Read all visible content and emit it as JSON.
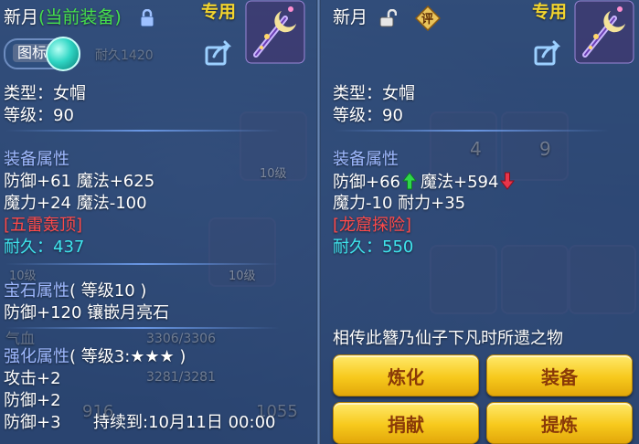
{
  "left": {
    "title_name": "新月",
    "title_status": "(当前装备)",
    "exclusive_label": "专用",
    "icon_toggle_label": "图标",
    "type_line": "类型：女帽",
    "level_line": "等级：90",
    "attr_header": "装备属性",
    "attr_line1": "防御+61 魔法+625",
    "attr_line2": "魔力+24 魔法-100",
    "special_skill": "[五雷轰顶]",
    "durability_label": "耐久：",
    "durability_value": "437",
    "gem_header": "宝石属性",
    "gem_level": "( 等级10 )",
    "gem_line": "防御+120 镶嵌月亮石",
    "enhance_header": "强化属性",
    "enhance_level": "( 等级3:★★★ )",
    "enhance_line1": "攻击+2",
    "enhance_line2": "防御+2",
    "enhance_line3": "防御+3",
    "expiry": "持续到:10月11日 00:00"
  },
  "right": {
    "title_name": "新月",
    "eval_badge": "评",
    "exclusive_label": "专用",
    "type_line": "类型：女帽",
    "level_line": "等级：90",
    "attr_header": "装备属性",
    "attr_def": "防御+66",
    "attr_magic": "魔法+594",
    "attr_line2": "魔力-10 耐力+35",
    "special_skill": "[龙窟探险]",
    "durability_label": "耐久：",
    "durability_value": "550",
    "description": "相传此簪乃仙子下凡时所遗之物",
    "buttons": {
      "refine": "炼化",
      "equip": "装备",
      "donate": "捐献",
      "extract": "提炼"
    }
  },
  "background": {
    "tile_level_1": "10级",
    "tile_level_2": "10级",
    "tile_level_3": "10级",
    "tile_num_4": "4",
    "tile_num_9": "9",
    "hp_bar": "3306/3306",
    "mp_bar": "3281/3281",
    "qi_label": "气血",
    "durability_faint": "耐久1420",
    "stat_916": "916",
    "stat_1055": "1055"
  },
  "colors": {
    "up_arrow": "#2fd64a",
    "down_arrow": "#e8354a",
    "button_text": "#8a3a08",
    "accent_cyan": "#3fe6ee",
    "skill_red": "#ff4a4a"
  }
}
